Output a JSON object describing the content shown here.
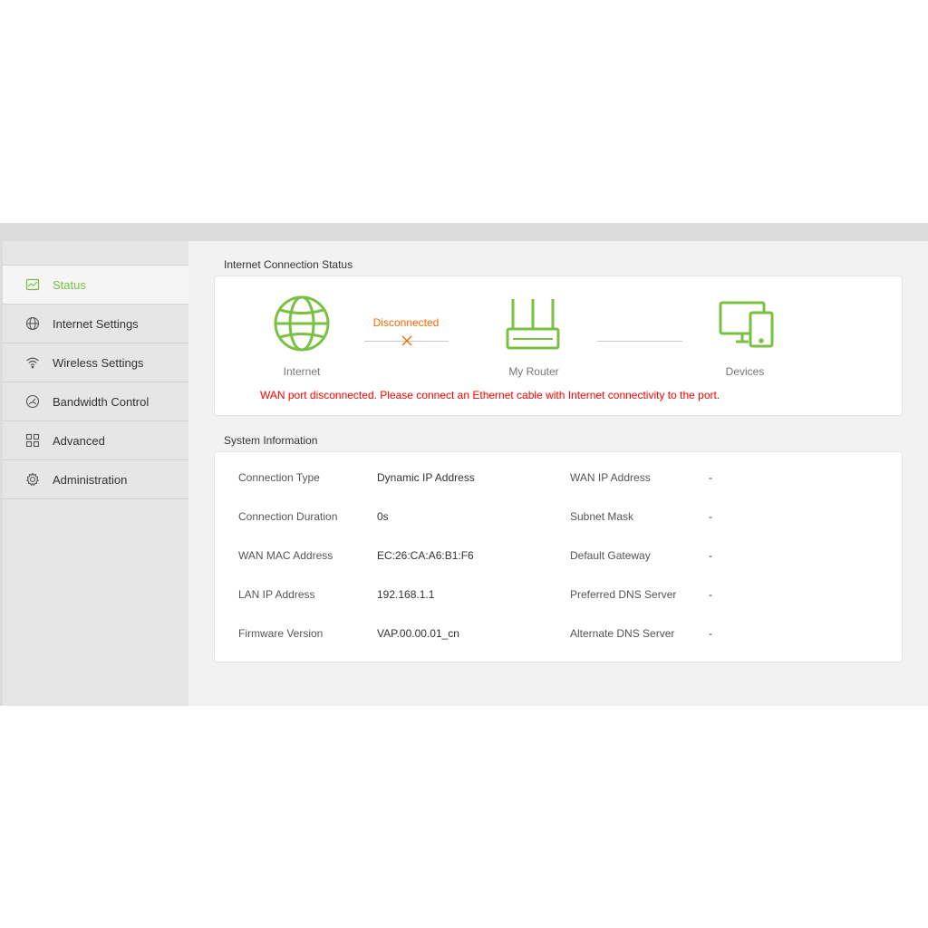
{
  "sidebar": {
    "items": [
      {
        "label": "Status",
        "icon": "status-chart-icon",
        "active": true
      },
      {
        "label": "Internet Settings",
        "icon": "globe-icon",
        "active": false
      },
      {
        "label": "Wireless Settings",
        "icon": "wifi-icon",
        "active": false
      },
      {
        "label": "Bandwidth Control",
        "icon": "gauge-icon",
        "active": false
      },
      {
        "label": "Advanced",
        "icon": "grid-icon",
        "active": false
      },
      {
        "label": "Administration",
        "icon": "gear-icon",
        "active": false
      }
    ]
  },
  "connection": {
    "title": "Internet Connection Status",
    "internet_label": "Internet",
    "router_label": "My Router",
    "devices_label": "Devices",
    "status": "Disconnected",
    "error": "WAN port disconnected. Please connect an Ethernet cable with Internet connectivity to the port."
  },
  "system": {
    "title": "System Information",
    "left": [
      {
        "label": "Connection Type",
        "value": "Dynamic IP Address"
      },
      {
        "label": "Connection Duration",
        "value": "0s"
      },
      {
        "label": "WAN MAC Address",
        "value": "EC:26:CA:A6:B1:F6"
      },
      {
        "label": "LAN IP Address",
        "value": "192.168.1.1"
      },
      {
        "label": "Firmware Version",
        "value": "VAP.00.00.01_cn"
      }
    ],
    "right": [
      {
        "label": "WAN IP Address",
        "value": "-"
      },
      {
        "label": "Subnet Mask",
        "value": "-"
      },
      {
        "label": "Default Gateway",
        "value": "-"
      },
      {
        "label": "Preferred DNS Server",
        "value": "-"
      },
      {
        "label": "Alternate DNS Server",
        "value": "-"
      }
    ]
  },
  "colors": {
    "accent": "#7ac142",
    "error": "#ff0000",
    "warning": "#ff6600"
  }
}
